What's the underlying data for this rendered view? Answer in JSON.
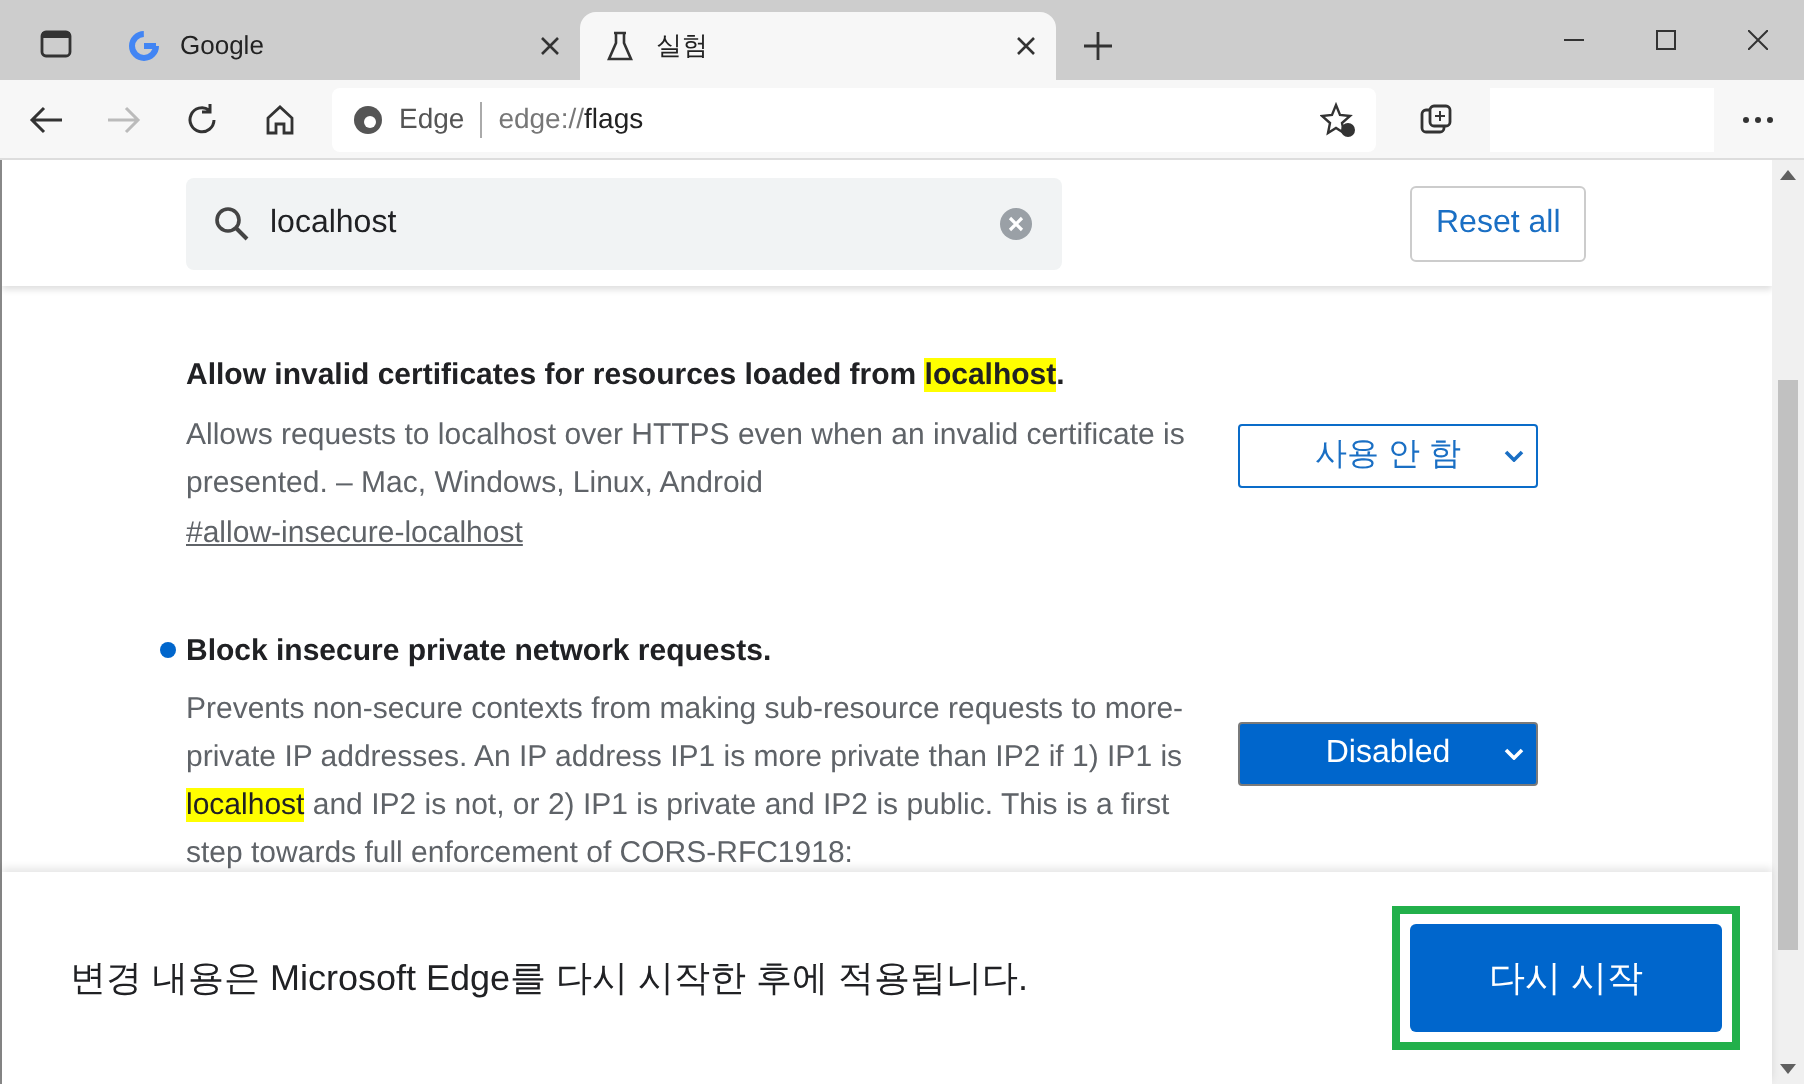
{
  "tabs": [
    {
      "title": "Google",
      "selected": false
    },
    {
      "title": "실험",
      "selected": true
    }
  ],
  "address_bar": {
    "site_label": "Edge",
    "url_prefix": "edge://",
    "url_host": "flags"
  },
  "search": {
    "value": "localhost"
  },
  "reset_button": "Reset all",
  "flags": [
    {
      "modified": false,
      "name": [
        {
          "text": "Allow invalid certificates for resources loaded from ",
          "highlighted": false
        },
        {
          "text": "localhost",
          "highlighted": true
        },
        {
          "text": ".",
          "highlighted": false
        }
      ],
      "description": [
        {
          "text": "Allows requests to localhost over HTTPS even when an invalid certificate is presented. – Mac, Windows, Linux, Android",
          "highlighted": false
        }
      ],
      "anchor": "#allow-insecure-localhost",
      "value": "사용 안 함"
    },
    {
      "modified": true,
      "name": [
        {
          "text": "Block insecure private network requests.",
          "highlighted": false
        }
      ],
      "description": [
        {
          "text": "Prevents non-secure contexts from making sub-resource requests to more-private IP addresses. An IP address IP1 is more private than IP2 if 1) IP1 is ",
          "highlighted": false
        },
        {
          "text": "localhost",
          "highlighted": true
        },
        {
          "text": " and IP2 is not, or 2) IP1 is private and IP2 is public. This is a first step towards full enforcement of CORS-RFC1918:",
          "highlighted": false
        }
      ],
      "value": "Disabled"
    }
  ],
  "restart_bar": {
    "message": "변경 내용은 Microsoft Edge를 다시 시작한 후에 적용됩니다.",
    "button": "다시 시작",
    "highlighted": true
  }
}
